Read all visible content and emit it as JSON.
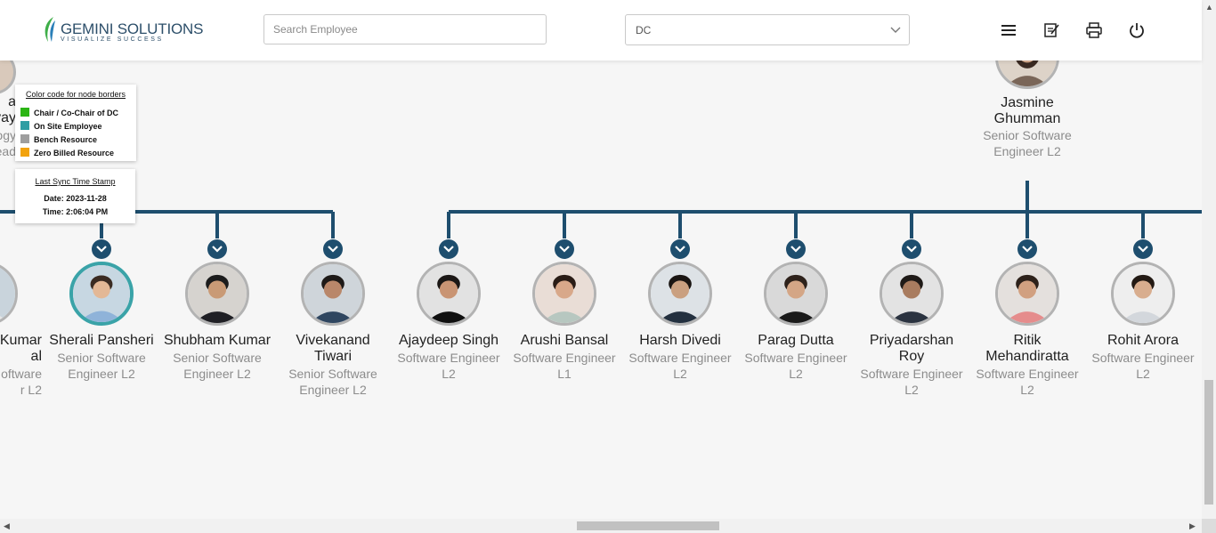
{
  "header": {
    "logo_name": "GEMINI SOLUTIONS",
    "logo_tagline": "VISUALIZE SUCCESS",
    "search_placeholder": "Search Employee",
    "dropdown_value": "DC",
    "icons": [
      "menu-icon",
      "notes-icon",
      "print-icon",
      "power-icon"
    ]
  },
  "legend": {
    "title": "Color code for node borders",
    "items": [
      {
        "label": "Chair / Co-Chair of DC",
        "color": "#2bb514"
      },
      {
        "label": "On Site Employee",
        "color": "#2e9ea3"
      },
      {
        "label": "Bench Resource",
        "color": "#9e9e9e"
      },
      {
        "label": "Zero Billed Resource",
        "color": "#f2a20c"
      }
    ]
  },
  "sync": {
    "title": "Last Sync Time Stamp",
    "date": "Date: 2023-11-28",
    "time": "Time: 2:06:04 PM"
  },
  "partial_left_parent": {
    "name_lines": [
      "a",
      "vay"
    ],
    "role_lines": [
      "ogy",
      "ead"
    ]
  },
  "parent": {
    "name": "Jasmine Ghumman",
    "role": "Senior Software Engineer L2"
  },
  "children": [
    {
      "name": "Kumar\nal",
      "role": "oftware\nr L2"
    },
    {
      "name": "Sherali Pansheri",
      "role": "Senior Software Engineer L2"
    },
    {
      "name": "Shubham Kumar",
      "role": "Senior Software Engineer L2"
    },
    {
      "name": "Vivekanand Tiwari",
      "role": "Senior Software Engineer L2"
    },
    {
      "name": "Ajaydeep Singh",
      "role": "Software Engineer L2"
    },
    {
      "name": "Arushi Bansal",
      "role": "Software Engineer L1"
    },
    {
      "name": "Harsh Divedi",
      "role": "Software Engineer L2"
    },
    {
      "name": "Parag Dutta",
      "role": "Software Engineer L2"
    },
    {
      "name": "Priyadarshan Roy",
      "role": "Software Engineer L2"
    },
    {
      "name": "Ritik Mehandiratta",
      "role": "Software Engineer L2"
    },
    {
      "name": "Rohit Arora",
      "role": "Software Engineer L2"
    }
  ],
  "colors": {
    "connector": "#1e4e6e",
    "onsite_border": "#3aa3a8",
    "default_border": "#b3b3b3"
  }
}
